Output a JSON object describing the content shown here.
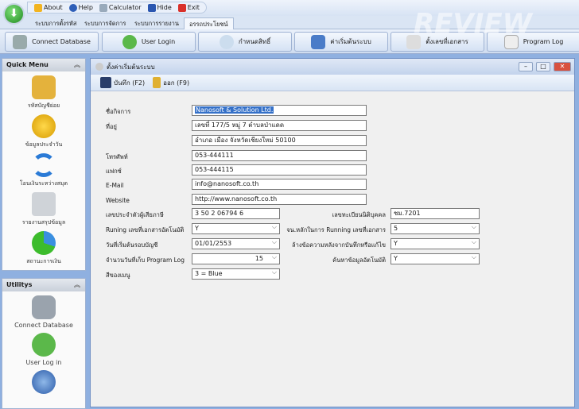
{
  "quick_access": {
    "about": "About",
    "help": "Help",
    "calculator": "Calculator",
    "hide": "Hide",
    "exit": "Exit"
  },
  "tabs": [
    "ระบบการตั้งรหัส",
    "ระบบการจัดการ",
    "ระบบการรายงาน",
    "อรรถประโยชน์"
  ],
  "ribbon": [
    "Connect Database",
    "User Login",
    "กำหนดสิทธิ์",
    "ค่าเริ่มต้นระบบ",
    "ตั้งเลขที่เอกสาร",
    "Program Log"
  ],
  "quick_menu": {
    "title": "Quick Menu",
    "items": [
      "รหัสบัญชีย่อย",
      "ข้อมูลประจำวัน",
      "โอนเงินระหว่างสมุด",
      "รายงานสรุปข้อมูล",
      "สถานะการเงิน"
    ]
  },
  "utilitys": {
    "title": "Utilitys",
    "items": [
      "Connect Database",
      "User Log in"
    ]
  },
  "window": {
    "title": "ตั้งค่าเริ่มต้นระบบ",
    "save": "บันทึก (F2)",
    "exit": "ออก (F9)"
  },
  "form": {
    "company_label": "ชื่อกิจการ",
    "company": "Nanosoft & Solution Ltd.",
    "address_label": "ที่อยู่",
    "address1": "เลขที่ 177/5 หมู่ 7 ตำบลป่าแดด",
    "address2": "อำเภอ เมือง จังหวัดเชียงใหม่ 50100",
    "phone_label": "โทรศัพท์",
    "phone": "053-444111",
    "fax_label": "แฟกซ์",
    "fax": "053-444115",
    "email_label": "E-Mail",
    "email": "info@nanosoft.co.th",
    "website_label": "Website",
    "website": "http://www.nanosoft.co.th",
    "taxid_label": "เลขประจำตัวผู้เสียภาษี",
    "taxid": "3 50 2 06794 6",
    "reg_label": "เลขทะเบียนนิติบุคคล",
    "reg": "ชม.7201",
    "autorun_label": "Runing เลขที่เอกสารอัตโนมัติ",
    "autorun": "Y",
    "digits_label": "จน.หลักในการ Running เลขที่เอกสาร",
    "digits": "5",
    "start_label": "วันที่เริ่มต้นรอบบัญชี",
    "start": "01/01/2553",
    "clear_label": "ล้างข้อความหลังจากบันทึกหรือแก้ไข",
    "clear": "Y",
    "logdays_label": "จำนวนวันที่เก็บ Program Log",
    "logdays": "15",
    "search_label": "ค้นหาข้อมูลอัตโนมัติ",
    "search": "Y",
    "color_label": "สีของเมนู",
    "color": "3 = Blue"
  },
  "watermark": "THAIWARE REVIEW"
}
